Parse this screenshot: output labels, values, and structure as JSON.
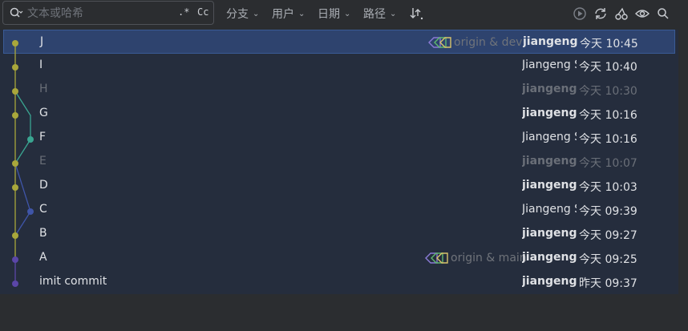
{
  "search": {
    "placeholder": "文本或哈希",
    "regex_label": ".*",
    "case_label": "Cc"
  },
  "filters": [
    {
      "label": "分支"
    },
    {
      "label": "用户"
    },
    {
      "label": "日期"
    },
    {
      "label": "路径"
    }
  ],
  "toolbar_icons": [
    "sort-icon",
    "play-icon",
    "refresh-icon",
    "cherry-pick-icon",
    "eye-icon",
    "search-icon"
  ],
  "colors": {
    "accent_yellow": "#a9a73b",
    "teal": "#3aa591",
    "blue": "#3f55a8",
    "purple": "#5b46a8",
    "selection": "#2e436e"
  },
  "commits": [
    {
      "subject": "J",
      "refs": "origin & dev",
      "author": "jiangeng",
      "date": "今天 10:45",
      "selected": true
    },
    {
      "subject": "I",
      "refs": "",
      "author": "Jiangeng Sun",
      "date": "今天 10:40"
    },
    {
      "subject": "H",
      "refs": "",
      "author": "jiangeng",
      "date": "今天 10:30",
      "dim": true
    },
    {
      "subject": "G",
      "refs": "",
      "author": "jiangeng",
      "date": "今天 10:16"
    },
    {
      "subject": "F",
      "refs": "",
      "author": "Jiangeng Sun",
      "date": "今天 10:16"
    },
    {
      "subject": "E",
      "refs": "",
      "author": "jiangeng",
      "date": "今天 10:07",
      "dim": true
    },
    {
      "subject": "D",
      "refs": "",
      "author": "jiangeng",
      "date": "今天 10:03"
    },
    {
      "subject": "C",
      "refs": "",
      "author": "Jiangeng Sun",
      "date": "今天 09:39"
    },
    {
      "subject": "B",
      "refs": "",
      "author": "jiangeng",
      "date": "今天 09:27"
    },
    {
      "subject": "A",
      "refs": "origin & main",
      "author": "jiangeng",
      "date": "今天 09:25"
    },
    {
      "subject": "imit commit",
      "refs": "",
      "author": "jiangeng",
      "date": "昨天 09:37"
    }
  ]
}
